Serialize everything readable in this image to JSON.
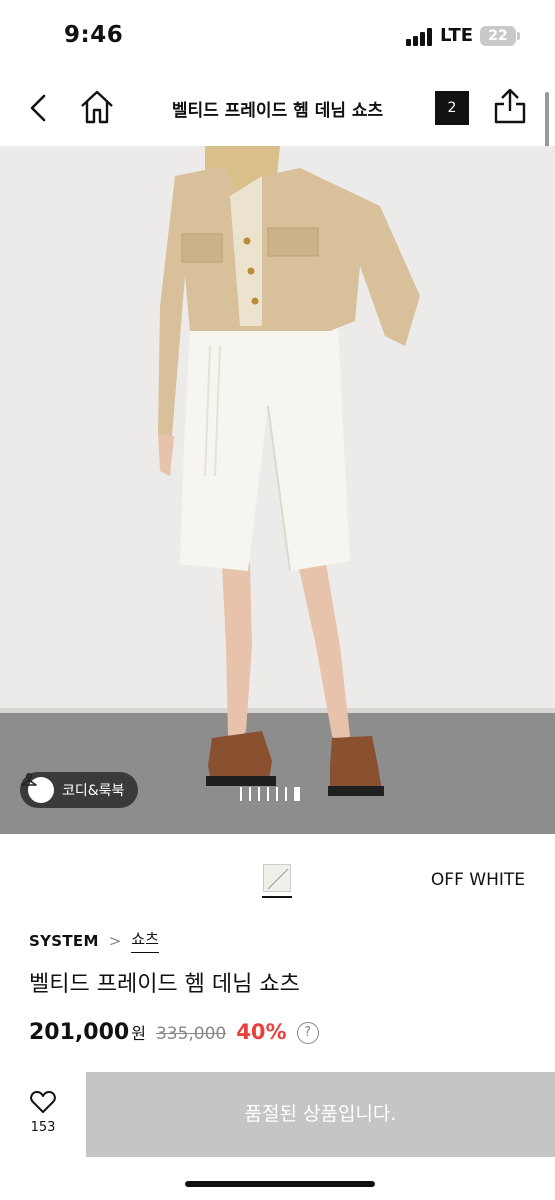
{
  "status": {
    "time": "9:46",
    "network": "LTE",
    "battery": "22"
  },
  "nav": {
    "title": "벨티드 프레이드 헴 데님 쇼츠",
    "count": "2"
  },
  "hero": {
    "codi_label": "코디&룩북",
    "dots_total": 7,
    "dots_active": 7
  },
  "color": {
    "name": "OFF WHITE"
  },
  "product": {
    "brand": "SYSTEM",
    "crumb_arrow": ">",
    "category": "쇼츠",
    "name": "벨티드 프레이드 헴 데님 쇼츠",
    "price": "201,000",
    "currency": "원",
    "original_price": "335,000",
    "discount": "40%",
    "info": "?"
  },
  "actions": {
    "likes": "153",
    "soldout_label": "품절된 상품입니다."
  },
  "icons": [
    "back-icon",
    "home-icon",
    "share-icon",
    "hanger-icon",
    "heart-icon",
    "info-icon"
  ]
}
